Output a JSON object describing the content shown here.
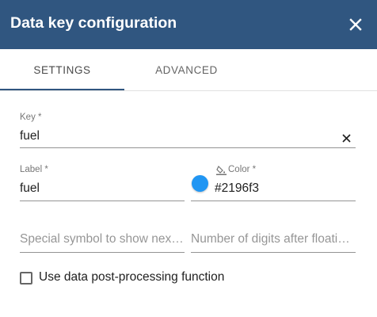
{
  "dialog": {
    "title": "Data key configuration",
    "header_color": "#305680",
    "close_icon": "close-icon"
  },
  "tabs": [
    {
      "label": "SETTINGS",
      "active": true
    },
    {
      "label": "ADVANCED",
      "active": false
    }
  ],
  "fields": {
    "key": {
      "label": "Key *",
      "value": "fuel",
      "clear_icon": "close-icon"
    },
    "label": {
      "label": "Label *",
      "value": "fuel"
    },
    "color": {
      "label": "Color *",
      "value": "#2196f3",
      "swatch": "#2196f3",
      "icon": "format-color-fill-icon"
    },
    "units": {
      "placeholder": "Special symbol to show next to value"
    },
    "decimals": {
      "placeholder": "Number of digits after floating point"
    }
  },
  "postprocessing": {
    "label": "Use data post-processing function",
    "checked": false
  }
}
